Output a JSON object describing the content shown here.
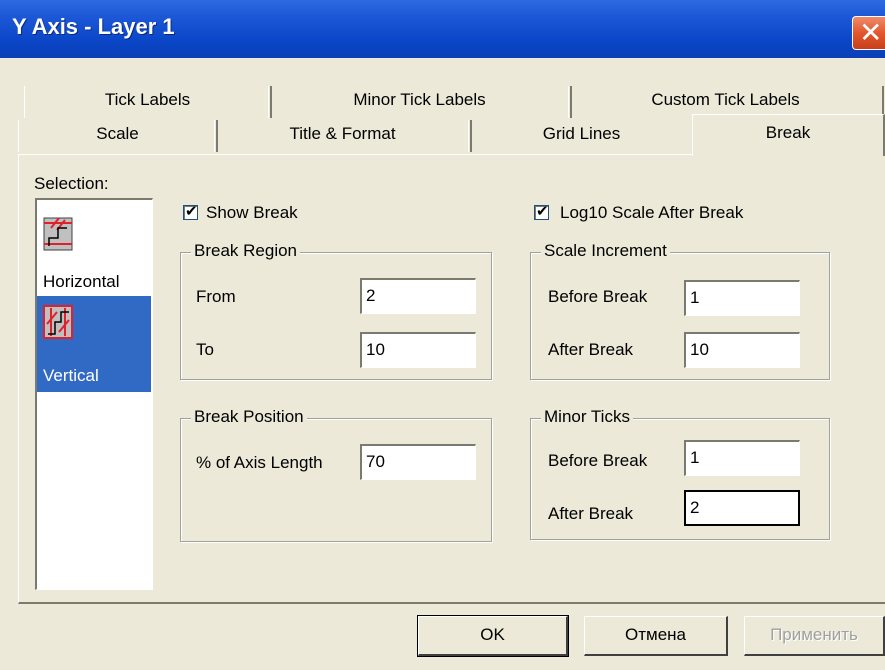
{
  "window": {
    "title": "Y Axis - Layer 1",
    "close_symbol": "✕"
  },
  "tabs_row1": [
    "Tick Labels",
    "Minor Tick Labels",
    "Custom Tick Labels"
  ],
  "tabs_row2": [
    "Scale",
    "Title & Format",
    "Grid Lines",
    "Break"
  ],
  "active_tab": "Break",
  "selection": {
    "label": "Selection:",
    "items": [
      {
        "label": "Horizontal",
        "icon": "horizontal-break-icon",
        "selected": false
      },
      {
        "label": "Vertical",
        "icon": "vertical-break-icon",
        "selected": true
      }
    ]
  },
  "show_break": {
    "label": "Show Break",
    "checked": true
  },
  "log10_scale": {
    "label": "Log10 Scale After Break",
    "checked": true
  },
  "break_region": {
    "title": "Break Region",
    "from_label": "From",
    "from_value": "2",
    "to_label": "To",
    "to_value": "10"
  },
  "break_position": {
    "title": "Break Position",
    "axis_length_label": "% of Axis Length",
    "axis_length_value": "70"
  },
  "scale_increment": {
    "title": "Scale Increment",
    "before_label": "Before Break",
    "before_value": "1",
    "after_label": "After Break",
    "after_value": "10"
  },
  "minor_ticks": {
    "title": "Minor Ticks",
    "before_label": "Before Break",
    "before_value": "1",
    "after_label": "After Break",
    "after_value": "2"
  },
  "buttons": {
    "ok": "OK",
    "cancel": "Отмена",
    "apply": "Применить"
  },
  "colors": {
    "titlebar": "#0a46c7",
    "selection": "#316ac5",
    "face": "#ece9d8",
    "icon_red": "#e0202a"
  }
}
